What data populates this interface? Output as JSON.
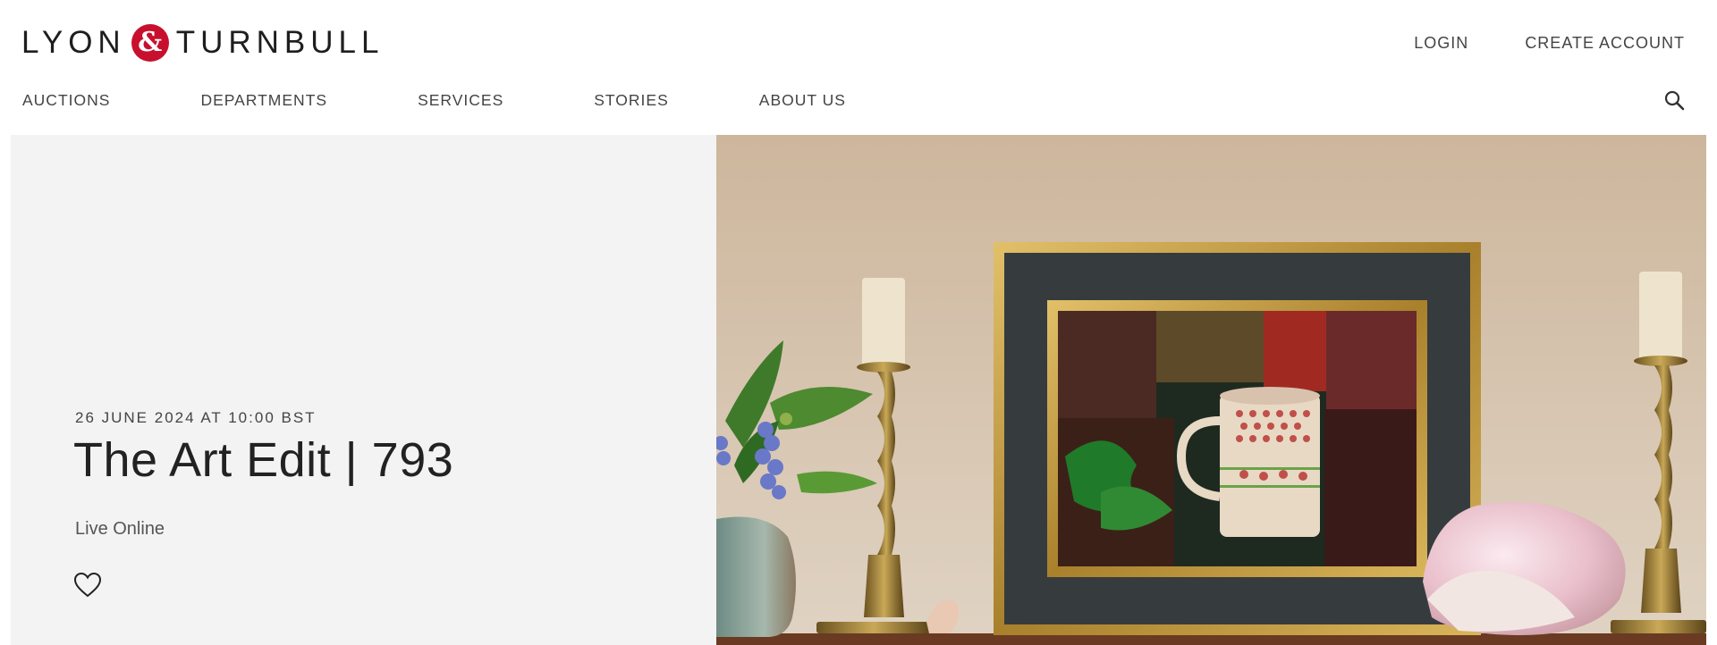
{
  "brand": {
    "left": "LYON",
    "amp": "&",
    "right": "TURNBULL",
    "accent_color": "#c8102e"
  },
  "account": {
    "login": "LOGIN",
    "create": "CREATE ACCOUNT"
  },
  "nav": {
    "items": [
      {
        "label": "AUCTIONS"
      },
      {
        "label": "DEPARTMENTS"
      },
      {
        "label": "SERVICES"
      },
      {
        "label": "STORIES"
      },
      {
        "label": "ABOUT US"
      }
    ],
    "search_icon": "search-icon"
  },
  "hero": {
    "date": "26 JUNE 2024 AT 10:00 BST",
    "title": "The Art Edit | 793",
    "subtitle": "Live Online",
    "favourite_icon": "heart-outline-icon",
    "image_icon": "still-life-photo"
  }
}
